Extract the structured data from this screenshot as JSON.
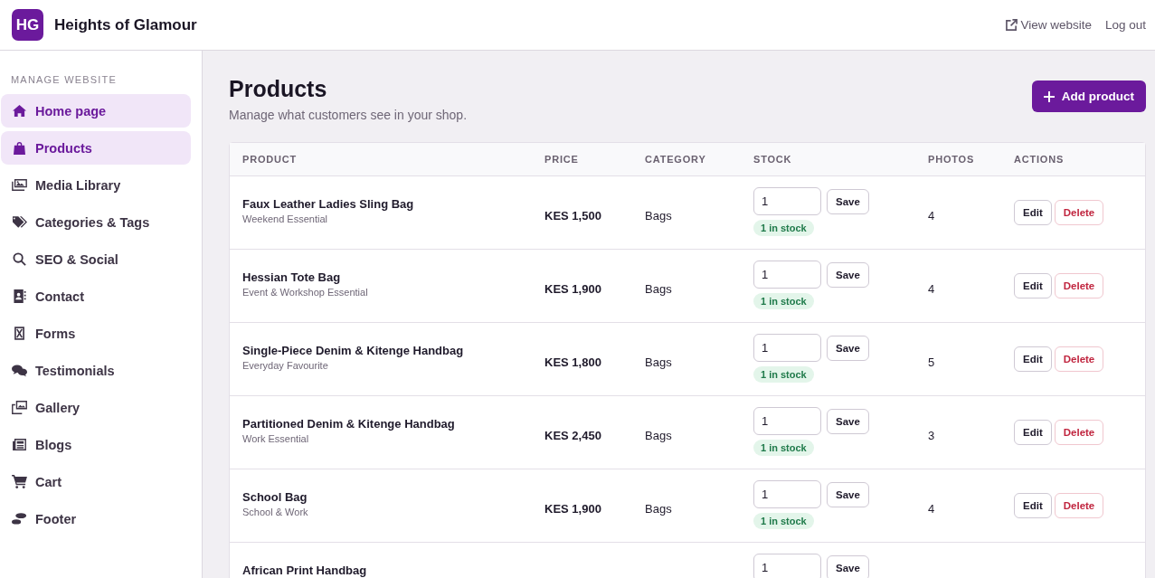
{
  "brand": {
    "logo": "HG",
    "name": "Heights of Glamour"
  },
  "header_links": [
    {
      "kind": "external",
      "label": "View website"
    },
    {
      "kind": "plain",
      "label": "Log out"
    }
  ],
  "sidebar": {
    "heading": "MANAGE WEBSITE",
    "items": [
      {
        "label": "Home page",
        "selected": true
      },
      {
        "label": "Products",
        "selected": true
      },
      {
        "label": "Media Library",
        "selected": false
      },
      {
        "label": "Categories & Tags",
        "selected": false
      },
      {
        "label": "SEO & Social",
        "selected": false
      },
      {
        "label": "Contact",
        "selected": false
      },
      {
        "label": "Forms",
        "selected": false
      },
      {
        "label": "Testimonials",
        "selected": false
      },
      {
        "label": "Gallery",
        "selected": false
      },
      {
        "label": "Blogs",
        "selected": false
      },
      {
        "label": "Cart",
        "selected": false
      },
      {
        "label": "Footer",
        "selected": false
      }
    ]
  },
  "page": {
    "title": "Products",
    "subtitle": "Manage what customers see in your shop.",
    "add_button": "Add product"
  },
  "table": {
    "columns": [
      "PRODUCT",
      "PRICE",
      "CATEGORY",
      "STOCK",
      "PHOTOS",
      "ACTIONS"
    ],
    "rows": [
      {
        "name": "Faux Leather Ladies Sling Bag",
        "tagline": "Weekend Essential",
        "price": "KES 1,500",
        "category": "Bags",
        "stock": "1",
        "save": "Save",
        "badge": "1 in stock",
        "photos": "4",
        "actions": [
          {
            "kind": "edit",
            "label": "Edit"
          },
          {
            "kind": "delete",
            "label": "Delete"
          }
        ]
      },
      {
        "name": "Hessian Tote Bag",
        "tagline": "Event & Workshop Essential",
        "price": "KES 1,900",
        "category": "Bags",
        "stock": "1",
        "save": "Save",
        "badge": "1 in stock",
        "photos": "4",
        "actions": [
          {
            "kind": "edit",
            "label": "Edit"
          },
          {
            "kind": "delete",
            "label": "Delete"
          }
        ]
      },
      {
        "name": "Single-Piece Denim & Kitenge Handbag",
        "tagline": "Everyday Favourite",
        "price": "KES 1,800",
        "category": "Bags",
        "stock": "1",
        "save": "Save",
        "badge": "1 in stock",
        "photos": "5",
        "actions": [
          {
            "kind": "edit",
            "label": "Edit"
          },
          {
            "kind": "delete",
            "label": "Delete"
          }
        ]
      },
      {
        "name": "Partitioned Denim & Kitenge Handbag",
        "tagline": "Work Essential",
        "price": "KES 2,450",
        "category": "Bags",
        "stock": "1",
        "save": "Save",
        "badge": "1 in stock",
        "photos": "3",
        "actions": [
          {
            "kind": "edit",
            "label": "Edit"
          },
          {
            "kind": "delete",
            "label": "Delete"
          }
        ]
      },
      {
        "name": "School Bag",
        "tagline": "School & Work",
        "price": "KES 1,900",
        "category": "Bags",
        "stock": "1",
        "save": "Save",
        "badge": "1 in stock",
        "photos": "4",
        "actions": [
          {
            "kind": "edit",
            "label": "Edit"
          },
          {
            "kind": "delete",
            "label": "Delete"
          }
        ]
      },
      {
        "name": "African Print Handbag",
        "stock": "1",
        "save": "Save"
      }
    ]
  }
}
